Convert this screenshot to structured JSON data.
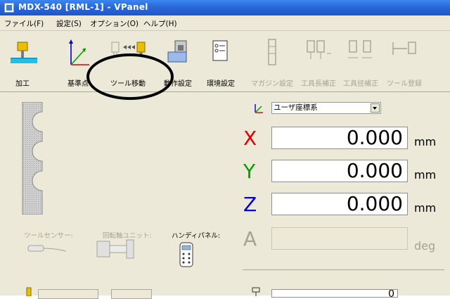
{
  "window": {
    "title": "MDX-540  [RML-1] - VPanel"
  },
  "menu": [
    "ファイル(F)",
    "設定(S)",
    "オプション(O)",
    "ヘルプ(H)"
  ],
  "toolbar": {
    "items": [
      {
        "label": "加工",
        "icon": "machining-icon",
        "enabled": true
      },
      {
        "label": "基準点",
        "icon": "origin-point-icon",
        "enabled": true
      },
      {
        "label": "ツール移動",
        "icon": "tool-move-icon",
        "enabled": true
      },
      {
        "label": "動作設定",
        "icon": "operation-settings-icon",
        "enabled": true
      },
      {
        "label": "環境設定",
        "icon": "environment-settings-icon",
        "enabled": true
      },
      {
        "label": "マガジン設定",
        "icon": "magazine-settings-icon",
        "enabled": false
      },
      {
        "label": "工具長補正",
        "icon": "tool-length-icon",
        "enabled": false
      },
      {
        "label": "工具径補正",
        "icon": "tool-diameter-icon",
        "enabled": false
      },
      {
        "label": "ツール登録",
        "icon": "tool-register-icon",
        "enabled": false
      }
    ]
  },
  "coordinate_system": {
    "selected": "ユーザ座標系"
  },
  "axes": [
    {
      "axis": "X",
      "value": "0.000",
      "unit": "mm",
      "color": "#e00000"
    },
    {
      "axis": "Y",
      "value": "0.000",
      "unit": "mm",
      "color": "#00a000"
    },
    {
      "axis": "Z",
      "value": "0.000",
      "unit": "mm",
      "color": "#0000d8"
    },
    {
      "axis": "A",
      "value": "",
      "unit": "deg",
      "color": "#a5a394"
    }
  ],
  "peripherals": {
    "tool_sensor": "ツールセンサー:",
    "rotary_unit": "回転軸ユニット:",
    "handy_panel": "ハンディパネル:"
  },
  "bottom_value": "0"
}
